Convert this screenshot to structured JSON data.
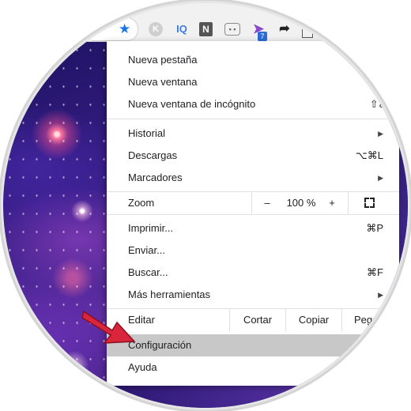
{
  "toolbar": {
    "extensions": {
      "k": "K",
      "iq": "IQ",
      "n": "N",
      "plane_badge": "7"
    }
  },
  "menu": {
    "new_tab": "Nueva pestaña",
    "new_window": "Nueva ventana",
    "incognito": "Nueva ventana de incógnito",
    "incognito_shortcut": "⇧⌘N",
    "history": "Historial",
    "downloads": "Descargas",
    "downloads_shortcut": "⌥⌘L",
    "bookmarks": "Marcadores",
    "zoom": {
      "label": "Zoom",
      "minus": "–",
      "value": "100 %",
      "plus": "+"
    },
    "print": "Imprimir...",
    "print_shortcut": "⌘P",
    "cast": "Enviar...",
    "find": "Buscar...",
    "find_shortcut": "⌘F",
    "more_tools": "Más herramientas",
    "edit": {
      "label": "Editar",
      "cut": "Cortar",
      "copy": "Copiar",
      "paste": "Pegar"
    },
    "settings": "Configuración",
    "help": "Ayuda"
  },
  "colors": {
    "accent": "#1a73e8",
    "highlight": "#c8c8c8",
    "pointer": "#d9263c"
  },
  "icons": [
    "star-icon",
    "extension-k-icon",
    "extension-iq-icon",
    "extension-n-icon",
    "extension-robot-icon",
    "extension-plane-icon",
    "share-arrow-icon",
    "fullscreen-icon",
    "submenu-arrow-icon",
    "red-pointer-arrow"
  ]
}
